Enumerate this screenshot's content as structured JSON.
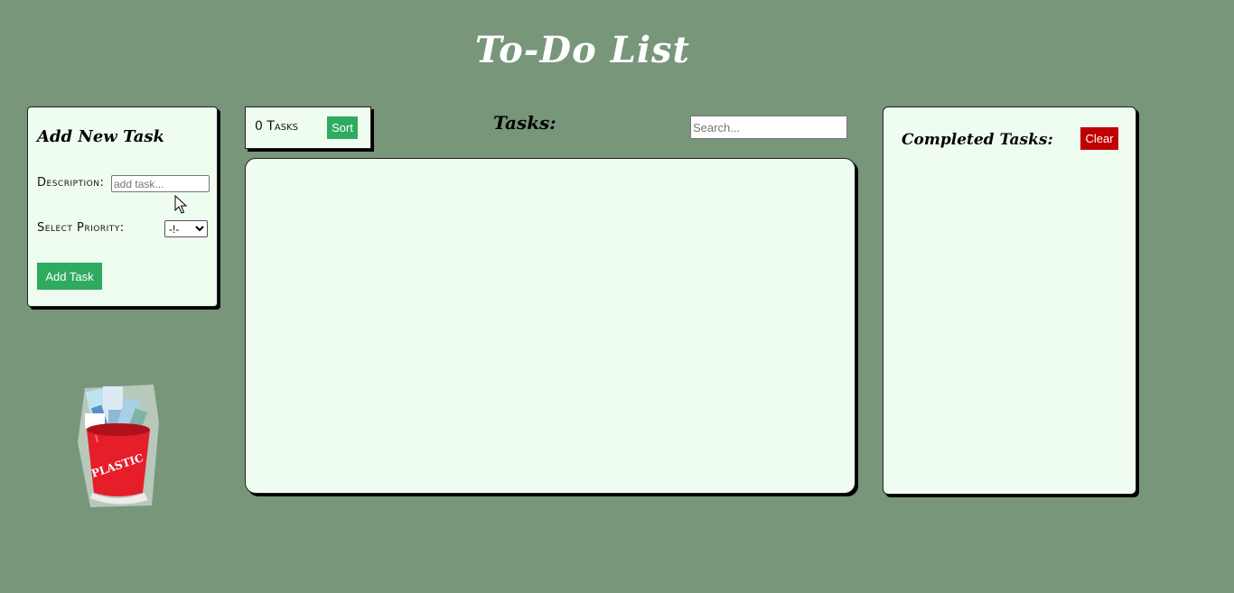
{
  "app": {
    "title": "To-Do List"
  },
  "add_panel": {
    "heading": "Add New Task",
    "description_label": "Description:",
    "description_placeholder": "add task...",
    "description_value": "",
    "priority_label": "Select Priority:",
    "priority_selected": "-!-",
    "add_button": "Add Task"
  },
  "tasks": {
    "count_label": "0 Tasks",
    "sort_button": "Sort",
    "heading": "Tasks:",
    "search_placeholder": "Search...",
    "items": []
  },
  "completed": {
    "heading": "Completed Tasks:",
    "clear_button": "Clear",
    "items": []
  },
  "illustration": {
    "label": "PLASTIC"
  },
  "colors": {
    "background": "#77967a",
    "panel": "#effdf0",
    "accent_green": "#2eab5f",
    "danger_red": "#c00000"
  }
}
